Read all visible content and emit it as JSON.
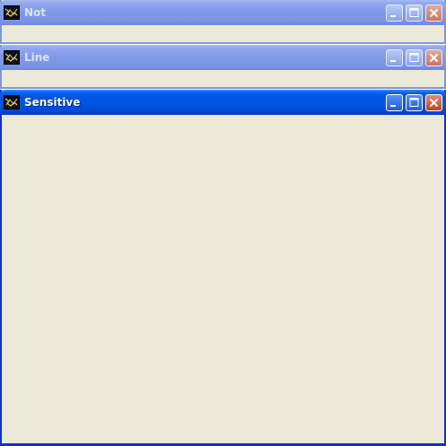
{
  "windows": [
    {
      "title": "Not",
      "state": "inactive"
    },
    {
      "title": "Line",
      "state": "inactive"
    },
    {
      "title": "Sensitive",
      "state": "active"
    }
  ],
  "icons": {
    "app": "app-window-icon",
    "minimize": "minimize-icon",
    "maximize": "maximize-icon",
    "close": "close-icon"
  },
  "colors": {
    "client_background": "#ece9d8",
    "active_titlebar": "#0054e3",
    "inactive_titlebar": "#7f99ea",
    "close_button": "#c4411f"
  }
}
